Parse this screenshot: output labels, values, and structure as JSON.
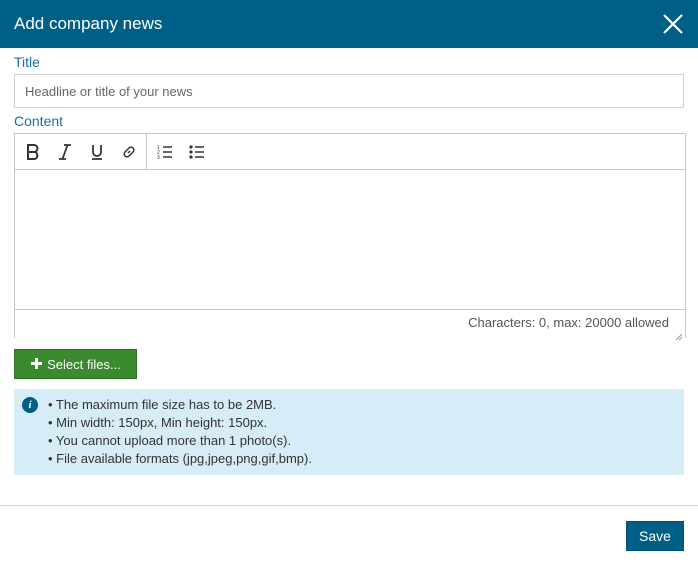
{
  "dialog": {
    "title": "Add company news",
    "close_icon": "close-icon"
  },
  "form": {
    "title_label": "Title",
    "title_placeholder": "Headline or title of your news",
    "title_value": "",
    "content_label": "Content",
    "toolbar": {
      "buttons": [
        "bold-icon",
        "italic-icon",
        "underline-icon",
        "link-icon",
        "ordered-list-icon",
        "unordered-list-icon"
      ]
    },
    "content_value": "",
    "char_count": "Characters: 0, max: 20000 allowed"
  },
  "upload": {
    "select_files_label": "Select files...",
    "info_icon": "info-icon",
    "rules": [
      "• The maximum file size has to be 2MB.",
      "• Min width: 150px, Min height: 150px.",
      "• You cannot upload more than 1 photo(s).",
      "• File available formats (jpg,jpeg,png,gif,bmp)."
    ]
  },
  "footer": {
    "save_label": "Save"
  },
  "colors": {
    "header": "#005f86",
    "info_bg": "#d6edf7",
    "select_files_bg": "#3a8b2e",
    "label": "#1d6fa0"
  }
}
